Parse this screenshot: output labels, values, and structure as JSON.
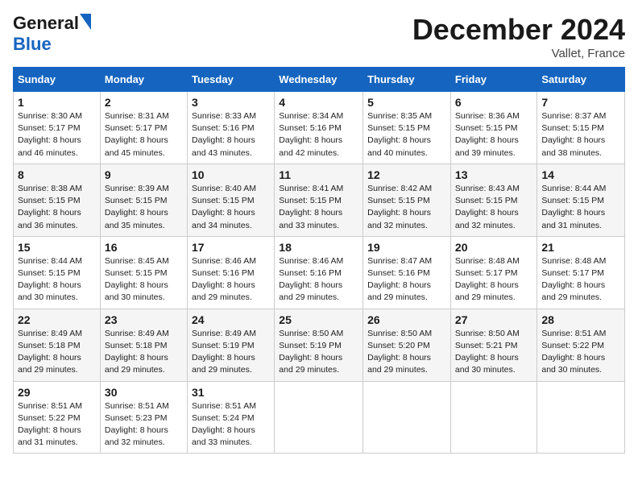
{
  "header": {
    "logo_general": "General",
    "logo_blue": "Blue",
    "month_title": "December 2024",
    "location": "Vallet, France"
  },
  "weekdays": [
    "Sunday",
    "Monday",
    "Tuesday",
    "Wednesday",
    "Thursday",
    "Friday",
    "Saturday"
  ],
  "weeks": [
    [
      {
        "day": "1",
        "sunrise": "Sunrise: 8:30 AM",
        "sunset": "Sunset: 5:17 PM",
        "daylight": "Daylight: 8 hours and 46 minutes."
      },
      {
        "day": "2",
        "sunrise": "Sunrise: 8:31 AM",
        "sunset": "Sunset: 5:17 PM",
        "daylight": "Daylight: 8 hours and 45 minutes."
      },
      {
        "day": "3",
        "sunrise": "Sunrise: 8:33 AM",
        "sunset": "Sunset: 5:16 PM",
        "daylight": "Daylight: 8 hours and 43 minutes."
      },
      {
        "day": "4",
        "sunrise": "Sunrise: 8:34 AM",
        "sunset": "Sunset: 5:16 PM",
        "daylight": "Daylight: 8 hours and 42 minutes."
      },
      {
        "day": "5",
        "sunrise": "Sunrise: 8:35 AM",
        "sunset": "Sunset: 5:15 PM",
        "daylight": "Daylight: 8 hours and 40 minutes."
      },
      {
        "day": "6",
        "sunrise": "Sunrise: 8:36 AM",
        "sunset": "Sunset: 5:15 PM",
        "daylight": "Daylight: 8 hours and 39 minutes."
      },
      {
        "day": "7",
        "sunrise": "Sunrise: 8:37 AM",
        "sunset": "Sunset: 5:15 PM",
        "daylight": "Daylight: 8 hours and 38 minutes."
      }
    ],
    [
      {
        "day": "8",
        "sunrise": "Sunrise: 8:38 AM",
        "sunset": "Sunset: 5:15 PM",
        "daylight": "Daylight: 8 hours and 36 minutes."
      },
      {
        "day": "9",
        "sunrise": "Sunrise: 8:39 AM",
        "sunset": "Sunset: 5:15 PM",
        "daylight": "Daylight: 8 hours and 35 minutes."
      },
      {
        "day": "10",
        "sunrise": "Sunrise: 8:40 AM",
        "sunset": "Sunset: 5:15 PM",
        "daylight": "Daylight: 8 hours and 34 minutes."
      },
      {
        "day": "11",
        "sunrise": "Sunrise: 8:41 AM",
        "sunset": "Sunset: 5:15 PM",
        "daylight": "Daylight: 8 hours and 33 minutes."
      },
      {
        "day": "12",
        "sunrise": "Sunrise: 8:42 AM",
        "sunset": "Sunset: 5:15 PM",
        "daylight": "Daylight: 8 hours and 32 minutes."
      },
      {
        "day": "13",
        "sunrise": "Sunrise: 8:43 AM",
        "sunset": "Sunset: 5:15 PM",
        "daylight": "Daylight: 8 hours and 32 minutes."
      },
      {
        "day": "14",
        "sunrise": "Sunrise: 8:44 AM",
        "sunset": "Sunset: 5:15 PM",
        "daylight": "Daylight: 8 hours and 31 minutes."
      }
    ],
    [
      {
        "day": "15",
        "sunrise": "Sunrise: 8:44 AM",
        "sunset": "Sunset: 5:15 PM",
        "daylight": "Daylight: 8 hours and 30 minutes."
      },
      {
        "day": "16",
        "sunrise": "Sunrise: 8:45 AM",
        "sunset": "Sunset: 5:15 PM",
        "daylight": "Daylight: 8 hours and 30 minutes."
      },
      {
        "day": "17",
        "sunrise": "Sunrise: 8:46 AM",
        "sunset": "Sunset: 5:16 PM",
        "daylight": "Daylight: 8 hours and 29 minutes."
      },
      {
        "day": "18",
        "sunrise": "Sunrise: 8:46 AM",
        "sunset": "Sunset: 5:16 PM",
        "daylight": "Daylight: 8 hours and 29 minutes."
      },
      {
        "day": "19",
        "sunrise": "Sunrise: 8:47 AM",
        "sunset": "Sunset: 5:16 PM",
        "daylight": "Daylight: 8 hours and 29 minutes."
      },
      {
        "day": "20",
        "sunrise": "Sunrise: 8:48 AM",
        "sunset": "Sunset: 5:17 PM",
        "daylight": "Daylight: 8 hours and 29 minutes."
      },
      {
        "day": "21",
        "sunrise": "Sunrise: 8:48 AM",
        "sunset": "Sunset: 5:17 PM",
        "daylight": "Daylight: 8 hours and 29 minutes."
      }
    ],
    [
      {
        "day": "22",
        "sunrise": "Sunrise: 8:49 AM",
        "sunset": "Sunset: 5:18 PM",
        "daylight": "Daylight: 8 hours and 29 minutes."
      },
      {
        "day": "23",
        "sunrise": "Sunrise: 8:49 AM",
        "sunset": "Sunset: 5:18 PM",
        "daylight": "Daylight: 8 hours and 29 minutes."
      },
      {
        "day": "24",
        "sunrise": "Sunrise: 8:49 AM",
        "sunset": "Sunset: 5:19 PM",
        "daylight": "Daylight: 8 hours and 29 minutes."
      },
      {
        "day": "25",
        "sunrise": "Sunrise: 8:50 AM",
        "sunset": "Sunset: 5:19 PM",
        "daylight": "Daylight: 8 hours and 29 minutes."
      },
      {
        "day": "26",
        "sunrise": "Sunrise: 8:50 AM",
        "sunset": "Sunset: 5:20 PM",
        "daylight": "Daylight: 8 hours and 29 minutes."
      },
      {
        "day": "27",
        "sunrise": "Sunrise: 8:50 AM",
        "sunset": "Sunset: 5:21 PM",
        "daylight": "Daylight: 8 hours and 30 minutes."
      },
      {
        "day": "28",
        "sunrise": "Sunrise: 8:51 AM",
        "sunset": "Sunset: 5:22 PM",
        "daylight": "Daylight: 8 hours and 30 minutes."
      }
    ],
    [
      {
        "day": "29",
        "sunrise": "Sunrise: 8:51 AM",
        "sunset": "Sunset: 5:22 PM",
        "daylight": "Daylight: 8 hours and 31 minutes."
      },
      {
        "day": "30",
        "sunrise": "Sunrise: 8:51 AM",
        "sunset": "Sunset: 5:23 PM",
        "daylight": "Daylight: 8 hours and 32 minutes."
      },
      {
        "day": "31",
        "sunrise": "Sunrise: 8:51 AM",
        "sunset": "Sunset: 5:24 PM",
        "daylight": "Daylight: 8 hours and 33 minutes."
      },
      null,
      null,
      null,
      null
    ]
  ]
}
